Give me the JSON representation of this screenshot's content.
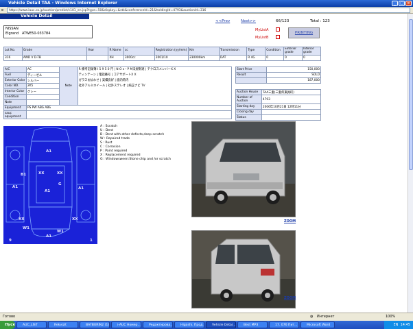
{
  "window": {
    "title": "Vehicle Detail TAA - Windows Internet Explorer",
    "url": "https://www.iauc.co.jp/auction/predict/c101_en.jsp?type=50&display=&stk&conferenceId=21&holdingId=4793&auctionId=316"
  },
  "header": {
    "heading": "Vehicle Detail",
    "prev_label": "<<Prev",
    "next_label": "Next>>",
    "position": "66/123",
    "total_label": "Total : 123",
    "mylist_a": "MyListA",
    "mylist_b": "MyListB",
    "printing_label": "PRINTING"
  },
  "vehicle": {
    "make": "NISSAN",
    "model": "Elgrand",
    "chassis": "ATWE50-033784"
  },
  "summary": {
    "headers": [
      "Lot No.",
      "Grade",
      "Year",
      "R Name",
      "cc",
      "Registration (yy/mm)",
      "Km",
      "Transmission",
      "Type",
      "Condition",
      "Exterior grade",
      "Interior grade"
    ],
    "values": [
      "316",
      "AWD V D-TB",
      "",
      "XH",
      "3000cc",
      "2001/10",
      "230000km",
      "DAT",
      "R 4G",
      "0",
      "0",
      "0"
    ]
  },
  "details": {
    "rows": [
      {
        "label": "A/C",
        "value": "AC"
      },
      {
        "label": "Fuel",
        "value": "ディーゼル"
      },
      {
        "label": "Exterior Color",
        "value": "シルバー"
      },
      {
        "label": "Color NO.",
        "value": "2K5"
      },
      {
        "label": "Interior Color",
        "value": "グレー"
      },
      {
        "label": "Condition",
        "value": ""
      },
      {
        "label": "Note",
        "value": ""
      }
    ],
    "equipment_label": "Equipment",
    "equipment_value": "PS PW ABG ABS",
    "equip2_label": "sauc equipment",
    "note_label": "Note",
    "note_lines": [
      "R 備考記録簿 I 5 9 5 0 円 | N O x・P M法規制適 | テクロスメンバーX X",
      "ティンテーン | 電話番号 | コアサポートX X",
      "ガラスお払わせ | 実績良好 | 面内荷内",
      "社外アルミホイール | 社外ステレオ | 純正ナビ TV"
    ]
  },
  "price": {
    "start_label": "Start Price",
    "start_value": "150,000",
    "result_label": "Result",
    "result_value": "SOLD",
    "final_value": "187,000"
  },
  "auction": {
    "house_label": "Auction House",
    "house_value": "TAA三重(三重県東員町)",
    "number_label": "Number of Auction",
    "number_value": "4793",
    "starting_label": "Starting day",
    "starting_value": "2006年10月21日 12時11分",
    "closing_label": "Closing day",
    "closing_value": "",
    "status_label": "Status",
    "status_value": ""
  },
  "diagram": {
    "labels": [
      "A1",
      "XX",
      "XX",
      "G",
      "B1",
      "A1",
      "A1",
      "A1",
      "XX",
      "XX",
      "W1",
      "W1",
      "A1",
      "9",
      "1"
    ]
  },
  "legend": [
    "A : Scratch",
    "U : Dent",
    "B : Dent with other defects,deep scratch",
    "W : Repaired trade",
    "S : Rust",
    "C : Corrosion",
    "P : Paint required",
    "X : Replacement required",
    "G : Windowsween:Stone chip and /or scratch"
  ],
  "photos": {
    "zoom_label": "ZOOM"
  },
  "statusbar": {
    "left": "Готово",
    "zone": "Интернет",
    "zoom": "100%"
  },
  "taskbar": {
    "start": "Пуск",
    "items": [
      "AUC_LIST",
      "Rekvizit",
      "BAYBURIN2 (1)",
      "i-AUC Номер...",
      "Редактирова...",
      "Higashi. Прод...",
      "Vehicle Detai...",
      "Best MP3",
      "17. 076 Пит...",
      "Microsoft Word"
    ],
    "lang": "EN",
    "time": "14:45"
  },
  "colors": {
    "accent": "#0a2d8f",
    "diagram_bg": "#1a22d8",
    "header_cell": "#dde3f5"
  }
}
